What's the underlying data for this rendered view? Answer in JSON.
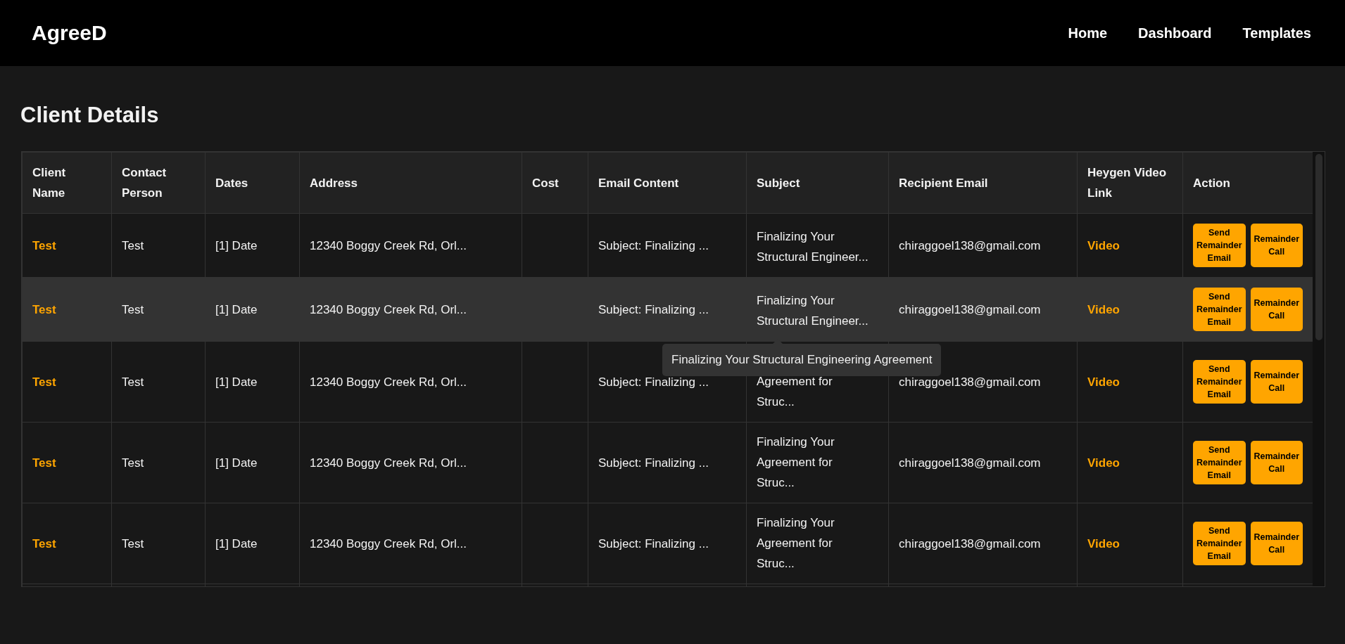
{
  "navbar": {
    "logo": "AgreeD",
    "links": [
      "Home",
      "Dashboard",
      "Templates"
    ]
  },
  "page_title": "Client Details",
  "table": {
    "columns": [
      "Client Name",
      "Contact Person",
      "Dates",
      "Address",
      "Cost",
      "Email Content",
      "Subject",
      "Recipient Email",
      "Heygen Video Link",
      "Action"
    ],
    "rows": [
      {
        "client_name": "Test",
        "contact_person": "Test",
        "dates": "[1] Date",
        "address": "12340 Boggy Creek Rd, Orl...",
        "email_content": "Subject: Finalizing ...",
        "subject": "Finalizing Your Structural Engineer...",
        "recipient_email": "chiraggoel138@gmail.com",
        "video_link": "Video",
        "actions": [
          "Send Remainder Email",
          "Remainder Call"
        ],
        "hovered": false
      },
      {
        "client_name": "Test",
        "contact_person": "Test",
        "dates": "[1] Date",
        "address": "12340 Boggy Creek Rd, Orl...",
        "email_content": "Subject: Finalizing ...",
        "subject": "Finalizing Your Structural Engineer...",
        "recipient_email": "chiraggoel138@gmail.com",
        "video_link": "Video",
        "actions": [
          "Send Remainder Email",
          "Remainder Call"
        ],
        "hovered": true
      },
      {
        "client_name": "Test",
        "contact_person": "Test",
        "dates": "[1] Date",
        "address": "12340 Boggy Creek Rd, Orl...",
        "email_content": "Subject: Finalizing ...",
        "subject": "Agreement for Struc...",
        "recipient_email": "chiraggoel138@gmail.com",
        "video_link": "Video",
        "actions": [
          "Send Remainder Email",
          "Remainder Call"
        ],
        "hovered": false
      },
      {
        "client_name": "Test",
        "contact_person": "Test",
        "dates": "[1] Date",
        "address": "12340 Boggy Creek Rd, Orl...",
        "email_content": "Subject: Finalizing ...",
        "subject": "Finalizing Your Agreement for Struc...",
        "recipient_email": "chiraggoel138@gmail.com",
        "video_link": "Video",
        "actions": [
          "Send Remainder Email",
          "Remainder Call"
        ],
        "hovered": false
      },
      {
        "client_name": "Test",
        "contact_person": "Test",
        "dates": "[1] Date",
        "address": "12340 Boggy Creek Rd, Orl...",
        "email_content": "Subject: Finalizing ...",
        "subject": "Finalizing Your Agreement for Struc...",
        "recipient_email": "chiraggoel138@gmail.com",
        "video_link": "Video",
        "actions": [
          "Send Remainder Email",
          "Remainder Call"
        ],
        "hovered": false
      }
    ],
    "tooltip": "Finalizing Your Structural Engineering Agreement"
  }
}
